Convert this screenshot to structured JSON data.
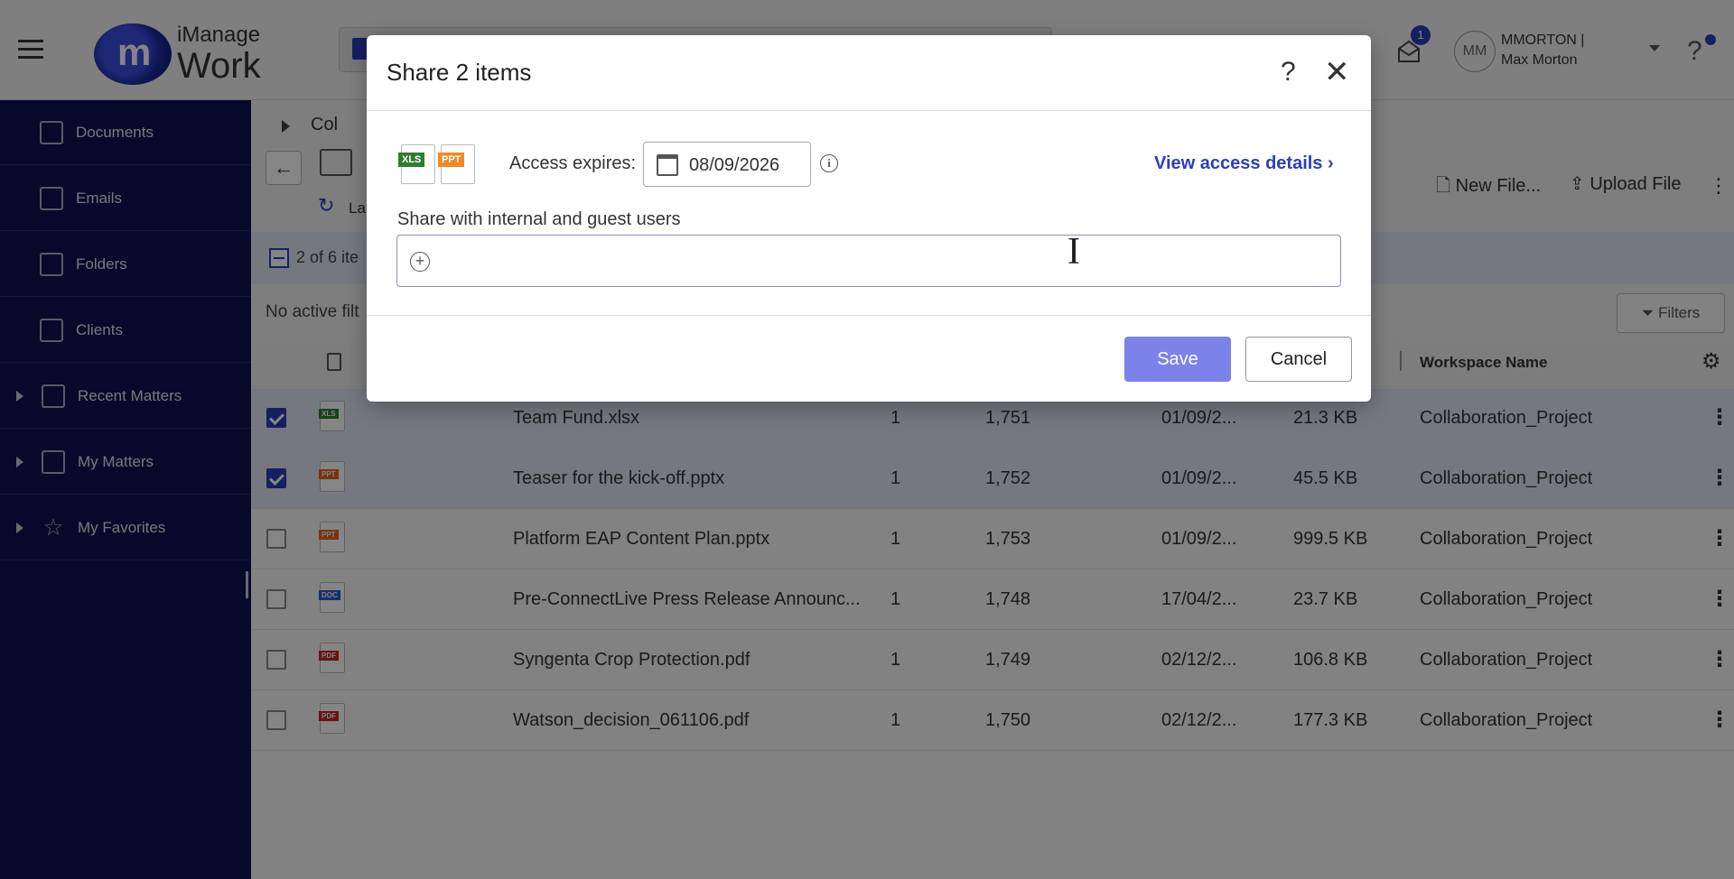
{
  "app": {
    "logo_line1": "iManage",
    "logo_line2": "Work",
    "notification_count": "1",
    "user_initials": "MM",
    "user_id": "MMORTON |",
    "user_name": "Max Morton",
    "help": "?"
  },
  "sidebar": {
    "items": [
      {
        "label": "Documents",
        "icon": "document-icon"
      },
      {
        "label": "Emails",
        "icon": "email-icon"
      },
      {
        "label": "Folders",
        "icon": "folder-icon"
      },
      {
        "label": "Clients",
        "icon": "briefcase-icon"
      },
      {
        "label": "Recent Matters",
        "icon": "recent-matters-icon"
      },
      {
        "label": "My Matters",
        "icon": "my-matters-icon"
      },
      {
        "label": "My Favorites",
        "icon": "star-icon"
      }
    ]
  },
  "main": {
    "breadcrumb": "Col",
    "back": "←",
    "refresh_label": "La",
    "new_file": "New File...",
    "upload_file": "Upload File",
    "selection_text": "2 of 6 ite",
    "filter_text": "No active filt",
    "filters_button": "Filters",
    "column_workspace": "Workspace Name",
    "rows": [
      {
        "name": "Team Fund.xlsx",
        "type": "XLS",
        "type_color": "#2e7d32",
        "version": "1",
        "number": "1,751",
        "date": "01/09/2...",
        "size": "21.3 KB",
        "workspace": "Collaboration_Project",
        "checked": true
      },
      {
        "name": "Teaser for the kick-off.pptx",
        "type": "PPT",
        "type_color": "#e0651e",
        "version": "1",
        "number": "1,752",
        "date": "01/09/2...",
        "size": "45.5 KB",
        "workspace": "Collaboration_Project",
        "checked": true
      },
      {
        "name": "Platform EAP Content Plan.pptx",
        "type": "PPT",
        "type_color": "#e0651e",
        "version": "1",
        "number": "1,753",
        "date": "01/09/2...",
        "size": "999.5 KB",
        "workspace": "Collaboration_Project",
        "checked": false
      },
      {
        "name": "Pre-ConnectLive Press Release Announc...",
        "type": "DOC",
        "type_color": "#2a5bd7",
        "version": "1",
        "number": "1,748",
        "date": "17/04/2...",
        "size": "23.7 KB",
        "workspace": "Collaboration_Project",
        "checked": false
      },
      {
        "name": "Syngenta Crop Protection.pdf",
        "type": "PDF",
        "type_color": "#c62828",
        "version": "1",
        "number": "1,749",
        "date": "02/12/2...",
        "size": "106.8 KB",
        "workspace": "Collaboration_Project",
        "checked": false
      },
      {
        "name": "Watson_decision_061106.pdf",
        "type": "PDF",
        "type_color": "#c62828",
        "version": "1",
        "number": "1,750",
        "date": "02/12/2...",
        "size": "177.3 KB",
        "workspace": "Collaboration_Project",
        "checked": false
      }
    ]
  },
  "dialog": {
    "title": "Share 2 items",
    "help": "?",
    "close": "✕",
    "file_icons": [
      {
        "label": "XLS",
        "color": "#2e7d32"
      },
      {
        "label": "PPT",
        "color": "#f08a24"
      }
    ],
    "access_expires_label": "Access expires:",
    "access_expires_value": "08/09/2026",
    "view_access_details": "View access details ›",
    "share_label": "Share with internal and guest users",
    "share_input_value": "",
    "save_label": "Save",
    "cancel_label": "Cancel"
  }
}
